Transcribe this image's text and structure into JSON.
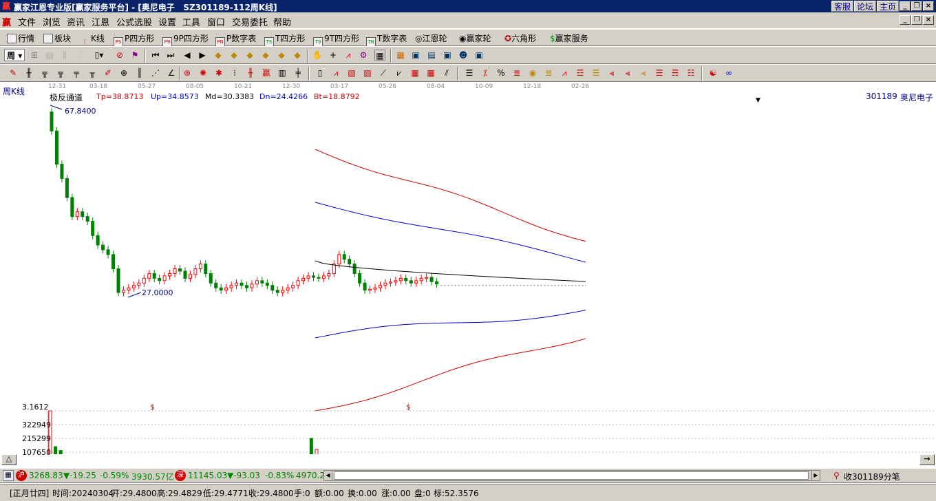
{
  "titlebar": {
    "title": "赢家江恩专业版[赢家服务平台] - [奥尼电子   SZ301189-112周K线]",
    "links": [
      "客服",
      "论坛",
      "主页"
    ]
  },
  "menu": [
    "文件",
    "浏览",
    "资讯",
    "江恩",
    "公式选股",
    "设置",
    "工具",
    "窗口",
    "交易委托",
    "帮助"
  ],
  "toolbar1": [
    "行情",
    "板块",
    "K线",
    "P四方形",
    "9P四方形",
    "P数字表",
    "T四方形",
    "9T四方形",
    "T数字表",
    "江恩轮",
    "赢家轮",
    "六角形",
    "赢家服务"
  ],
  "toolbar1_icons": [
    "",
    "",
    "",
    "PS",
    "P9",
    "PN",
    "TS",
    "T9",
    "TN",
    "",
    "",
    "",
    ""
  ],
  "period": {
    "button": "周",
    "label": "周K线"
  },
  "date_axis": [
    "12-31",
    "03-18",
    "05-27",
    "08-05",
    "10-21",
    "12-30",
    "03-17",
    "05-26",
    "08-04",
    "10-09",
    "12-18",
    "02-26"
  ],
  "indicator": {
    "name": "极反通道",
    "tp": "Tp=38.8713",
    "up": "Up=34.8573",
    "md": "Md=30.3383",
    "dn": "Dn=24.4266",
    "bt": "Bt=18.8792"
  },
  "stock": {
    "code": "301189",
    "name": "奥尼电子"
  },
  "price": {
    "max_label": "67.8400",
    "min_label": "27.0000"
  },
  "volume": {
    "labels": [
      "3.1612",
      "322949",
      "215299",
      "107650"
    ],
    "markers": [
      "$",
      "$"
    ]
  },
  "chart_data": {
    "type": "candlestick",
    "price_range": [
      27.0,
      67.84
    ],
    "channel": {
      "tp": 38.8713,
      "up": 34.8573,
      "md": 30.3383,
      "dn": 24.4266,
      "bt": 18.8792
    }
  },
  "index_bar": {
    "sh_icon": "沪",
    "sh_value": "3268.83",
    "sh_change": "▼-19.25",
    "sh_pct": "-0.59%",
    "sh_amount": "3930.57亿",
    "sz_icon": "深",
    "sz_value": "11145.03",
    "sz_change": "▼-93.03",
    "sz_pct": "-0.83%",
    "sz_amount": "4970.2",
    "right": "收301189分笔"
  },
  "status": {
    "date": "[正月廿四]",
    "time": "时间:20240304",
    "open": "开:29.4800",
    "high": "高:29.4829",
    "low": "低:29.4771",
    "close": "收:29.4800",
    "hand": "手:0",
    "amount": "额:0.00",
    "turnover": "换:0.00",
    "rise": "涨:0.00",
    "pan": "盘:0",
    "mark": "标:52.3576"
  },
  "colors": {
    "up": "#ff0000",
    "down": "#008000",
    "channel_up": "#cc0000",
    "channel_mid": "#0000cc",
    "channel_center": "#000000",
    "title_bg": "#0a246a"
  }
}
